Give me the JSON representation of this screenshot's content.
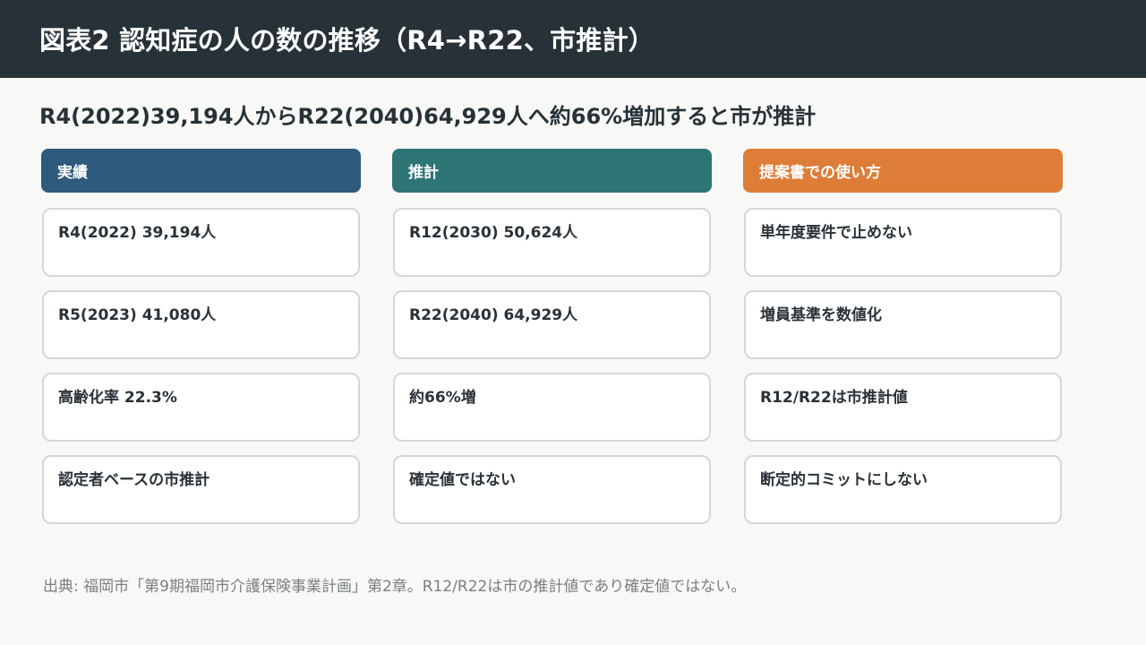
{
  "title": "図表2 認知症の人の数の推移（R4→R22、市推計）",
  "subtitle": "R4(2022)39,194人からR22(2040)64,929人へ約66%増加すると市が推計",
  "columns": [
    {
      "header": "実績",
      "color": "#2e5a7d",
      "items": [
        "R4(2022) 39,194人",
        "R5(2023) 41,080人",
        "高齢化率 22.3%",
        "認定者ベースの市推計"
      ]
    },
    {
      "header": "推計",
      "color": "#2e7675",
      "items": [
        "R12(2030) 50,624人",
        "R22(2040) 64,929人",
        "約66%増",
        "確定値ではない"
      ]
    },
    {
      "header": "提案書での使い方",
      "color": "#dd7d37",
      "items": [
        "単年度要件で止めない",
        "増員基準を数値化",
        "R12/R22は市推計値",
        "断定的コミットにしない"
      ]
    }
  ],
  "source": "出典: 福岡市「第9期福岡市介護保険事業計画」第2章。R12/R22は市の推計値であり確定値ではない。"
}
